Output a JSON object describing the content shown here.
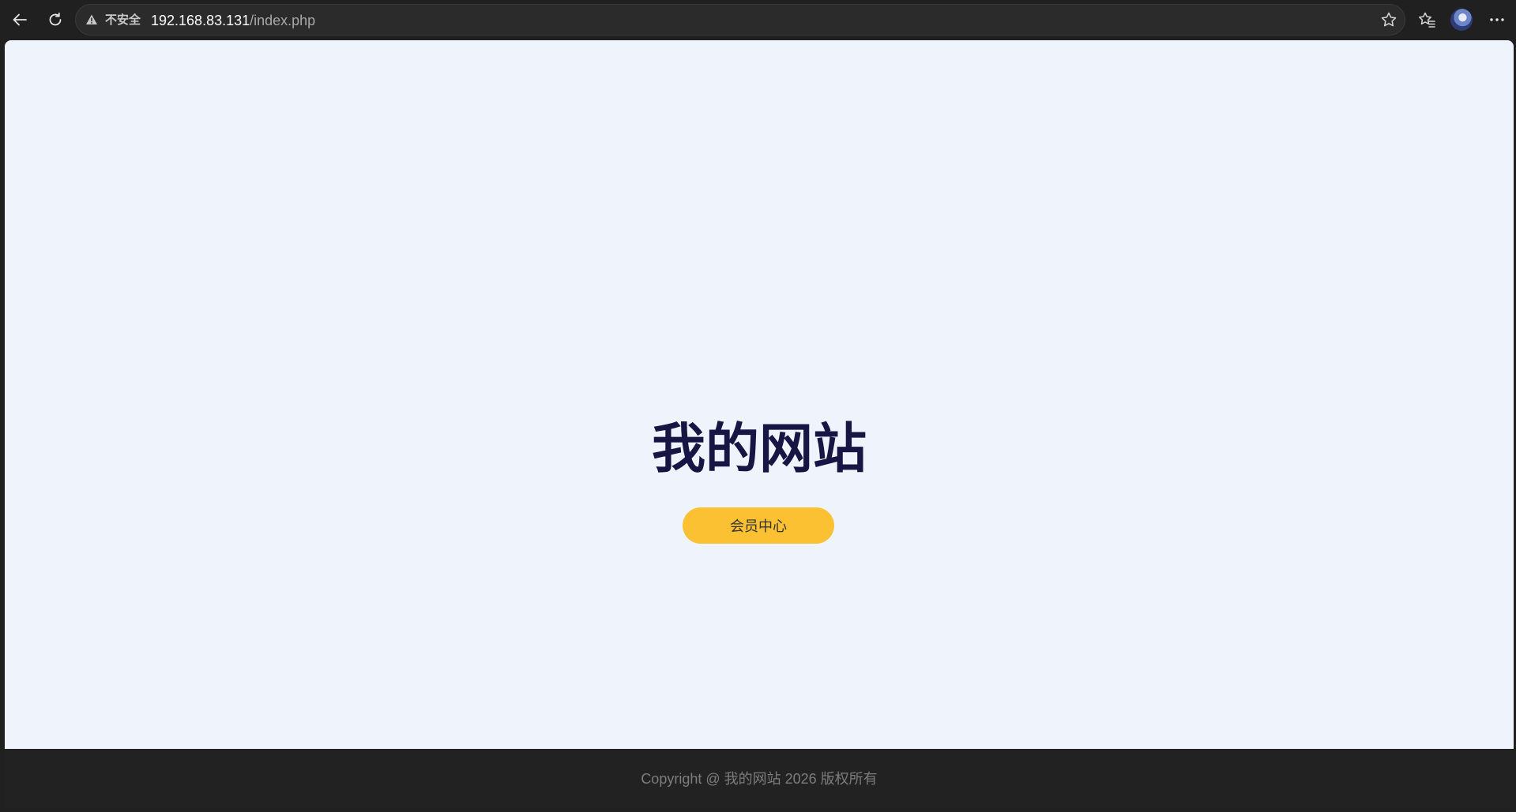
{
  "browser": {
    "security_label": "不安全",
    "url_host": "192.168.83.131",
    "url_path": "/index.php",
    "icons": [
      "back-arrow-icon",
      "reload-icon",
      "warning-icon",
      "star-icon",
      "favorites-icon",
      "avatar",
      "more-icon"
    ]
  },
  "page": {
    "title": "我的网站",
    "button_label": "会员中心",
    "footer_text": "Copyright @ 我的网站 2026 版权所有"
  },
  "colors": {
    "page_background": "#eff4fc",
    "title": "#161544",
    "button": "#fbc133",
    "footer_background": "#222222",
    "footer_text": "#7d7d7d"
  }
}
